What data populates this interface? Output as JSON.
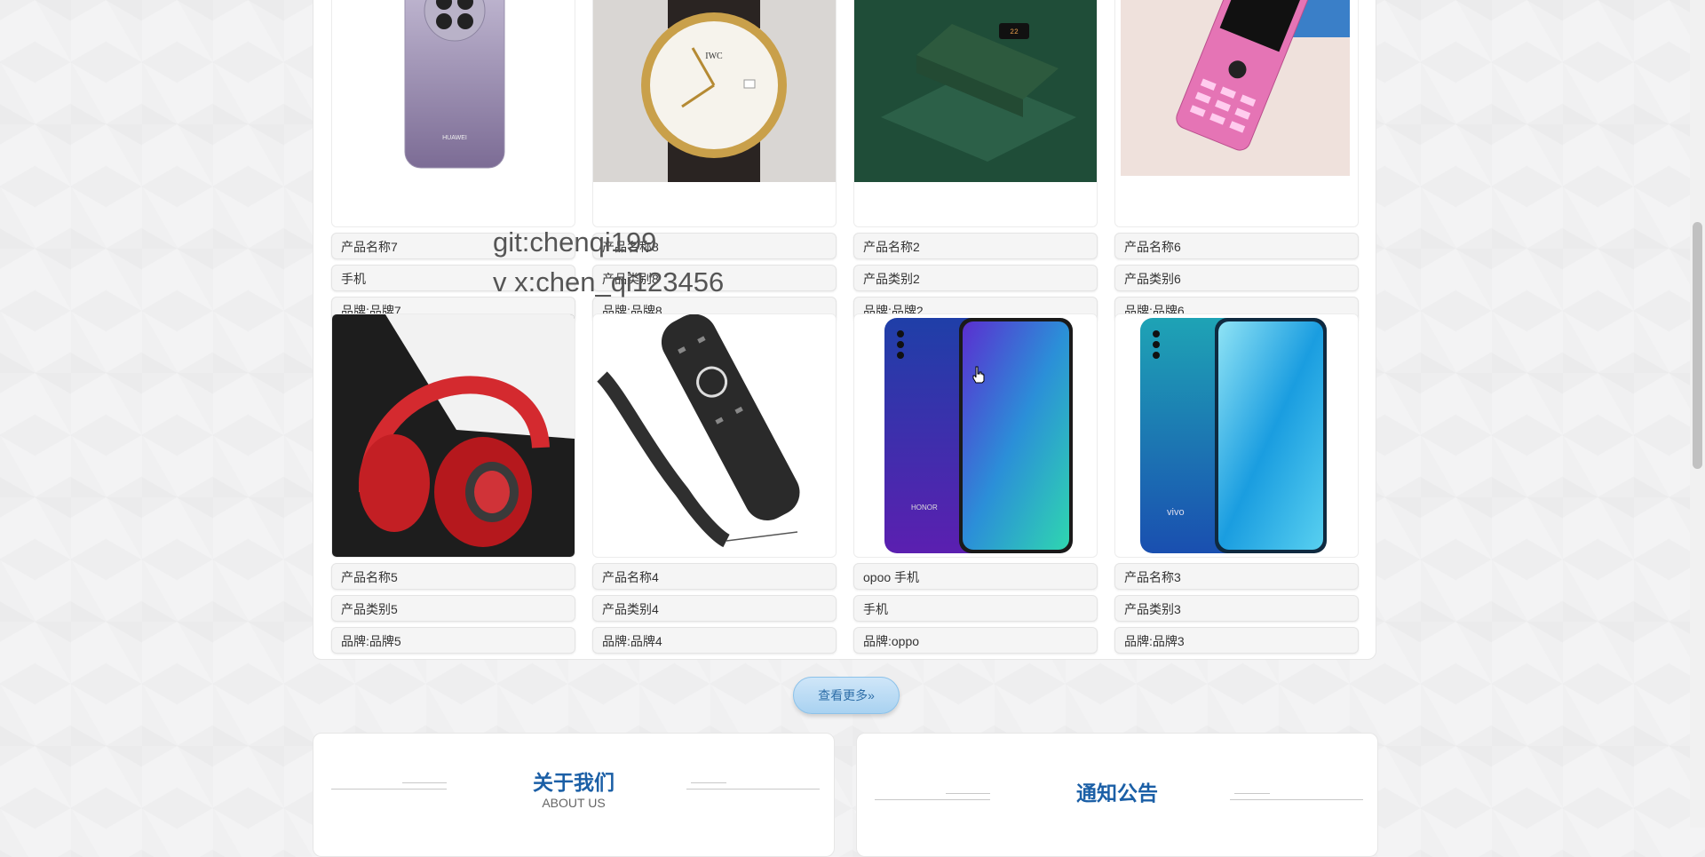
{
  "products": [
    {
      "name": "产品名称7",
      "category": "手机",
      "brand": "品牌:品牌7",
      "image": "purple-phone-image"
    },
    {
      "name": "产品名称8",
      "category": "产品类别8",
      "brand": "品牌:品牌8",
      "image": "watch-image"
    },
    {
      "name": "产品名称2",
      "category": "产品类别2",
      "brand": "品牌:品牌2",
      "image": "power-bank-image"
    },
    {
      "name": "产品名称6",
      "category": "产品类别6",
      "brand": "品牌:品牌6",
      "image": "pink-phone-image"
    },
    {
      "name": "产品名称5",
      "category": "产品类别5",
      "brand": "品牌:品牌5",
      "image": "headphones-image"
    },
    {
      "name": "产品名称4",
      "category": "产品类别4",
      "brand": "品牌:品牌4",
      "image": "remote-image"
    },
    {
      "name": "opoo 手机",
      "category": "手机",
      "brand": "品牌:oppo",
      "image": "honor-phone-image"
    },
    {
      "name": "产品名称3",
      "category": "产品类别3",
      "brand": "品牌:品牌3",
      "image": "vivo-phone-image"
    }
  ],
  "more_button": "查看更多»",
  "about": {
    "title": "关于我们",
    "subtitle": "ABOUT US"
  },
  "notice": {
    "title": "通知公告"
  },
  "watermark": {
    "line1": "git:chenqi199",
    "line2": "v x:chen_qi123456"
  },
  "colors": {
    "accent": "#1b5fa6",
    "button": "#a9d2f1"
  }
}
